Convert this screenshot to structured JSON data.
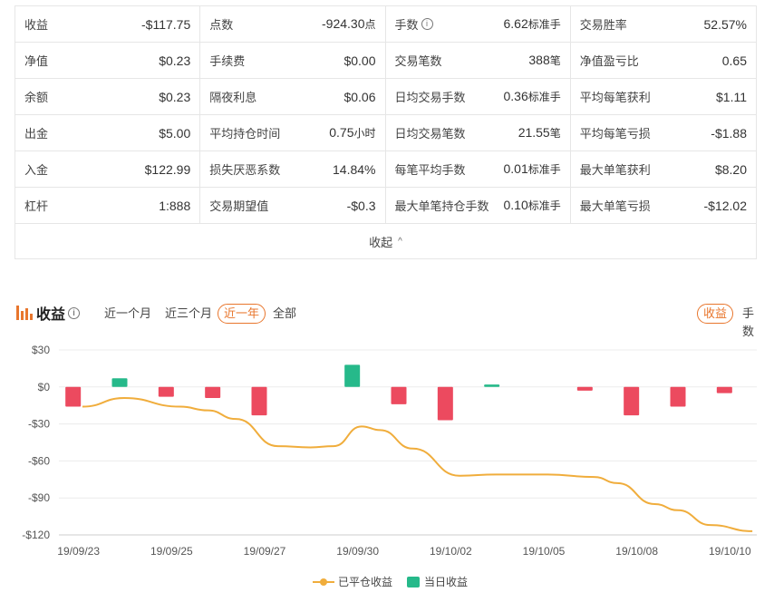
{
  "stats": {
    "rows": [
      [
        {
          "label": "收益",
          "value": "-$117.75",
          "unit": ""
        },
        {
          "label": "点数",
          "value": "-924.30",
          "unit": "点"
        },
        {
          "label": "手数",
          "value": "6.62",
          "unit": "标准手",
          "info": true
        },
        {
          "label": "交易胜率",
          "value": "52.57%",
          "unit": ""
        }
      ],
      [
        {
          "label": "净值",
          "value": "$0.23",
          "unit": ""
        },
        {
          "label": "手续费",
          "value": "$0.00",
          "unit": ""
        },
        {
          "label": "交易笔数",
          "value": "388",
          "unit": "笔"
        },
        {
          "label": "净值盈亏比",
          "value": "0.65",
          "unit": ""
        }
      ],
      [
        {
          "label": "余额",
          "value": "$0.23",
          "unit": ""
        },
        {
          "label": "隔夜利息",
          "value": "$0.06",
          "unit": ""
        },
        {
          "label": "日均交易手数",
          "value": "0.36",
          "unit": "标准手"
        },
        {
          "label": "平均每笔获利",
          "value": "$1.11",
          "unit": ""
        }
      ],
      [
        {
          "label": "出金",
          "value": "$5.00",
          "unit": ""
        },
        {
          "label": "平均持仓时间",
          "value": "0.75",
          "unit": "小时"
        },
        {
          "label": "日均交易笔数",
          "value": "21.55",
          "unit": "笔"
        },
        {
          "label": "平均每笔亏损",
          "value": "-$1.88",
          "unit": ""
        }
      ],
      [
        {
          "label": "入金",
          "value": "$122.99",
          "unit": ""
        },
        {
          "label": "损失厌恶系数",
          "value": "14.84%",
          "unit": ""
        },
        {
          "label": "每笔平均手数",
          "value": "0.01",
          "unit": "标准手"
        },
        {
          "label": "最大单笔获利",
          "value": "$8.20",
          "unit": ""
        }
      ],
      [
        {
          "label": "杠杆",
          "value": "1:888",
          "unit": ""
        },
        {
          "label": "交易期望值",
          "value": "-$0.3",
          "unit": ""
        },
        {
          "label": "最大单笔持仓手数",
          "value": "0.10",
          "unit": "标准手"
        },
        {
          "label": "最大单笔亏损",
          "value": "-$12.02",
          "unit": ""
        }
      ]
    ],
    "collapse_label": "收起"
  },
  "chart_header": {
    "title": "收益",
    "periods": [
      "近一个月",
      "近三个月",
      "近一年",
      "全部"
    ],
    "active_period": "近一年",
    "metrics": [
      "收益",
      "手数"
    ],
    "active_metric": "收益"
  },
  "colors": {
    "accent": "#e8762d",
    "line": "#f0ad3c",
    "positive": "#26b98a",
    "negative": "#ec4a5f"
  },
  "chart_data": {
    "type": "bar+line",
    "x_ticks": [
      "19/09/23",
      "19/09/25",
      "19/09/27",
      "19/09/30",
      "19/10/02",
      "19/10/05",
      "19/10/08",
      "19/10/10"
    ],
    "y_ticks": [
      "$30",
      "$0",
      "-$30",
      "-$60",
      "-$90",
      "-$120"
    ],
    "ylim": [
      -120,
      30
    ],
    "x_range": [
      0,
      15
    ],
    "bars": {
      "name": "当日收益",
      "x": [
        0,
        1,
        2,
        3,
        4,
        5,
        6,
        7,
        8,
        9,
        10,
        11,
        12,
        13,
        14
      ],
      "values": [
        -16,
        7,
        -8,
        -9,
        -23,
        0,
        18,
        -14,
        -27,
        2,
        0,
        -3,
        -23,
        -16,
        -5
      ]
    },
    "line": {
      "name": "已平仓收益",
      "x": [
        0.2,
        1.1,
        2.3,
        2.9,
        3.5,
        4.4,
        5.1,
        5.6,
        6.2,
        6.6,
        7.3,
        8.3,
        9.1,
        10.2,
        11.2,
        11.7,
        12.5,
        13.0,
        13.7,
        14.6
      ],
      "values": [
        -16,
        -9,
        -16,
        -19,
        -26,
        -48,
        -49,
        -48,
        -32,
        -35,
        -50,
        -72,
        -71,
        -71,
        -73,
        -78,
        -95,
        -100,
        -112,
        -117
      ]
    },
    "legend": [
      "已平仓收益",
      "当日收益"
    ],
    "grid": true
  }
}
